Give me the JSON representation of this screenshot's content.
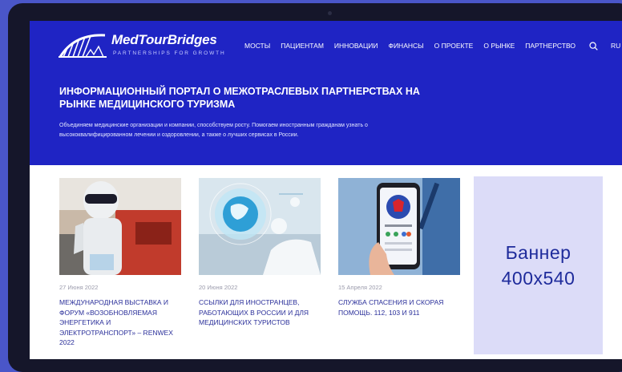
{
  "brand": {
    "name": "MedTourBridges",
    "tagline": "PARTNERSHIPS FOR GROWTH"
  },
  "nav": {
    "items": [
      "МОСТЫ",
      "ПАЦИЕНТАМ",
      "ИННОВАЦИИ",
      "ФИНАНСЫ",
      "О ПРОЕКТЕ",
      "О РЫНКЕ",
      "ПАРТНЕРСТВО"
    ],
    "search_icon": "search-icon",
    "language": "RU"
  },
  "hero": {
    "title": "ИНФОРМАЦИОННЫЙ ПОРТАЛ О МЕЖОТРАСЛЕВЫХ ПАРТНЕРСТВАХ НА РЫНКЕ МЕДИЦИНСКОГО ТУРИЗМА",
    "subtitle": "Объединяем медицинские организации и компании, способствуем росту. Помогаем иностранным гражданам узнать о высококвалифицированном лечении и оздоровлении, а также о лучших сервисах в России."
  },
  "news": [
    {
      "date": "27 Июня 2022",
      "title": "Международная выставка и форум «Возобновляемая энергетика и электротранспорт» – RENWEX 2022"
    },
    {
      "date": "20 Июня 2022",
      "title": "Ссылки для иностранцев, работающих в России и для медицинских туристов"
    },
    {
      "date": "15 Апреля 2022",
      "title": "Служба спасения и скорая помощь. 112, 103 и 911"
    }
  ],
  "banner": {
    "line1": "Баннер",
    "line2": "400x540"
  },
  "colors": {
    "hero_bg": "#1f24c4",
    "title_link": "#2a2f9a",
    "banner_bg": "#dcdcf8"
  }
}
